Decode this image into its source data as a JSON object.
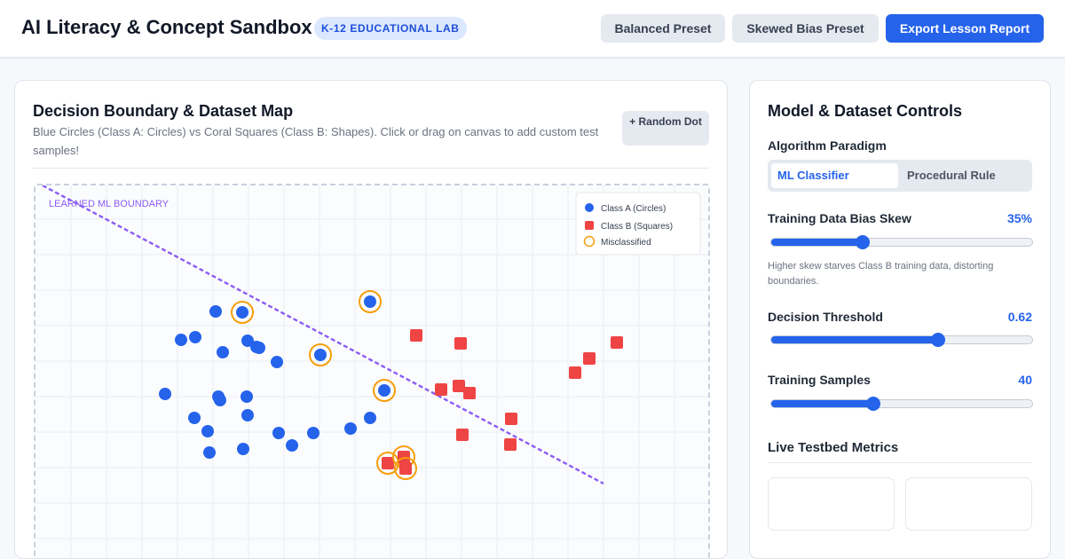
{
  "header": {
    "title": "AI Literacy & Concept Sandbox",
    "badge": "K-12 EDUCATIONAL LAB",
    "buttons": {
      "balanced": "Balanced Preset",
      "skewed": "Skewed Bias Preset",
      "export": "Export Lesson Report"
    }
  },
  "map": {
    "title": "Decision Boundary & Dataset Map",
    "description": "Blue Circles (Class A: Circles) vs Coral Squares (Class B: Shapes). Click or drag on canvas to add custom test samples!",
    "random_button": "+ Random Dot",
    "boundary_label": "LEARNED ML BOUNDARY",
    "legend": {
      "class_a": "Class A (Circles)",
      "class_b": "Class B (Squares)",
      "misclassified": "Misclassified"
    },
    "colors": {
      "class_a": "#2563eb",
      "class_b": "#ef4444",
      "misclassified": "#f59e0b",
      "boundary": "#8b5cf6"
    },
    "points": {
      "class_a": [
        [
          226,
          230
        ],
        [
          187,
          262
        ],
        [
          203,
          259
        ],
        [
          234,
          276
        ],
        [
          262,
          263
        ],
        [
          272,
          270
        ],
        [
          275,
          271
        ],
        [
          295,
          287
        ],
        [
          169,
          323
        ],
        [
          229,
          326
        ],
        [
          231,
          330
        ],
        [
          261,
          326
        ],
        [
          202,
          350
        ],
        [
          262,
          347
        ],
        [
          217,
          365
        ],
        [
          297,
          367
        ],
        [
          219,
          389
        ],
        [
          312,
          381
        ],
        [
          336,
          367
        ],
        [
          257,
          385
        ],
        [
          378,
          362
        ],
        [
          400,
          350
        ]
      ],
      "class_a_misclassified": [
        [
          256,
          231
        ],
        [
          400,
          219
        ],
        [
          344,
          279
        ],
        [
          416,
          319
        ]
      ],
      "class_b": [
        [
          452,
          257
        ],
        [
          502,
          266
        ],
        [
          631,
          299
        ],
        [
          647,
          283
        ],
        [
          678,
          265
        ],
        [
          480,
          318
        ],
        [
          500,
          314
        ],
        [
          512,
          322
        ],
        [
          559,
          351
        ],
        [
          504,
          369
        ],
        [
          558,
          380
        ]
      ],
      "class_b_misclassified": [
        [
          420,
          401
        ],
        [
          438,
          394
        ],
        [
          440,
          407
        ]
      ]
    }
  },
  "controls": {
    "title": "Model & Dataset Controls",
    "paradigm": {
      "label": "Algorithm Paradigm",
      "options": [
        "ML Classifier",
        "Procedural Rule"
      ],
      "selected": "ML Classifier"
    },
    "bias": {
      "label": "Training Data Bias Skew",
      "display": "35%",
      "fraction": 0.35,
      "hint": "Higher skew starves Class B training data, distorting boundaries."
    },
    "threshold": {
      "label": "Decision Threshold",
      "display": "0.62",
      "fraction": 0.64
    },
    "samples": {
      "label": "Training Samples",
      "display": "40",
      "fraction": 0.39
    },
    "metrics_title": "Live Testbed Metrics"
  }
}
